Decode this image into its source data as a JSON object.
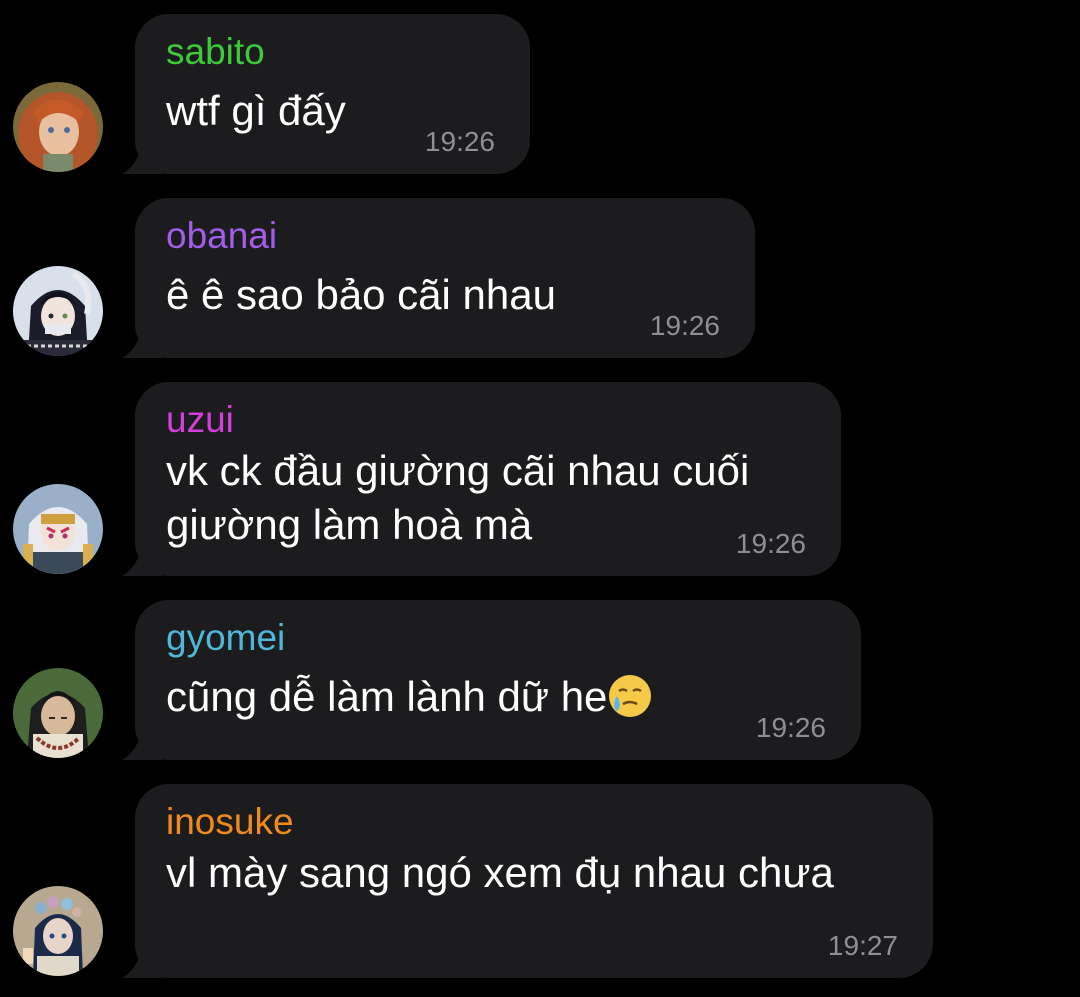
{
  "colors": {
    "background": "#000000",
    "bubble": "#1c1c1e",
    "time": "#8e8e93"
  },
  "messages": [
    {
      "sender": "sabito",
      "sender_color": "#3cc93a",
      "text_lines": [
        "wtf gì đấy"
      ],
      "time": "19:26",
      "avatar": "sabito-avatar"
    },
    {
      "sender": "obanai",
      "sender_color": "#a15ee8",
      "text_lines": [
        "ê ê sao bảo cãi nhau"
      ],
      "time": "19:26",
      "avatar": "obanai-avatar"
    },
    {
      "sender": "uzui",
      "sender_color": "#d43fdc",
      "text_lines": [
        "vk ck đầu giường cãi nhau cuối",
        "giường làm hoà mà"
      ],
      "time": "19:26",
      "avatar": "uzui-avatar"
    },
    {
      "sender": "gyomei",
      "sender_color": "#4eb8d8",
      "text_lines": [
        "cũng dễ làm lành dữ he"
      ],
      "emoji": "face-holding-back-tears-icon",
      "time": "19:26",
      "avatar": "gyomei-avatar"
    },
    {
      "sender": "inosuke",
      "sender_color": "#f08a1c",
      "text_lines": [
        "vl mày sang ngó xem đụ nhau chưa"
      ],
      "time": "19:27",
      "avatar": "inosuke-avatar"
    }
  ]
}
